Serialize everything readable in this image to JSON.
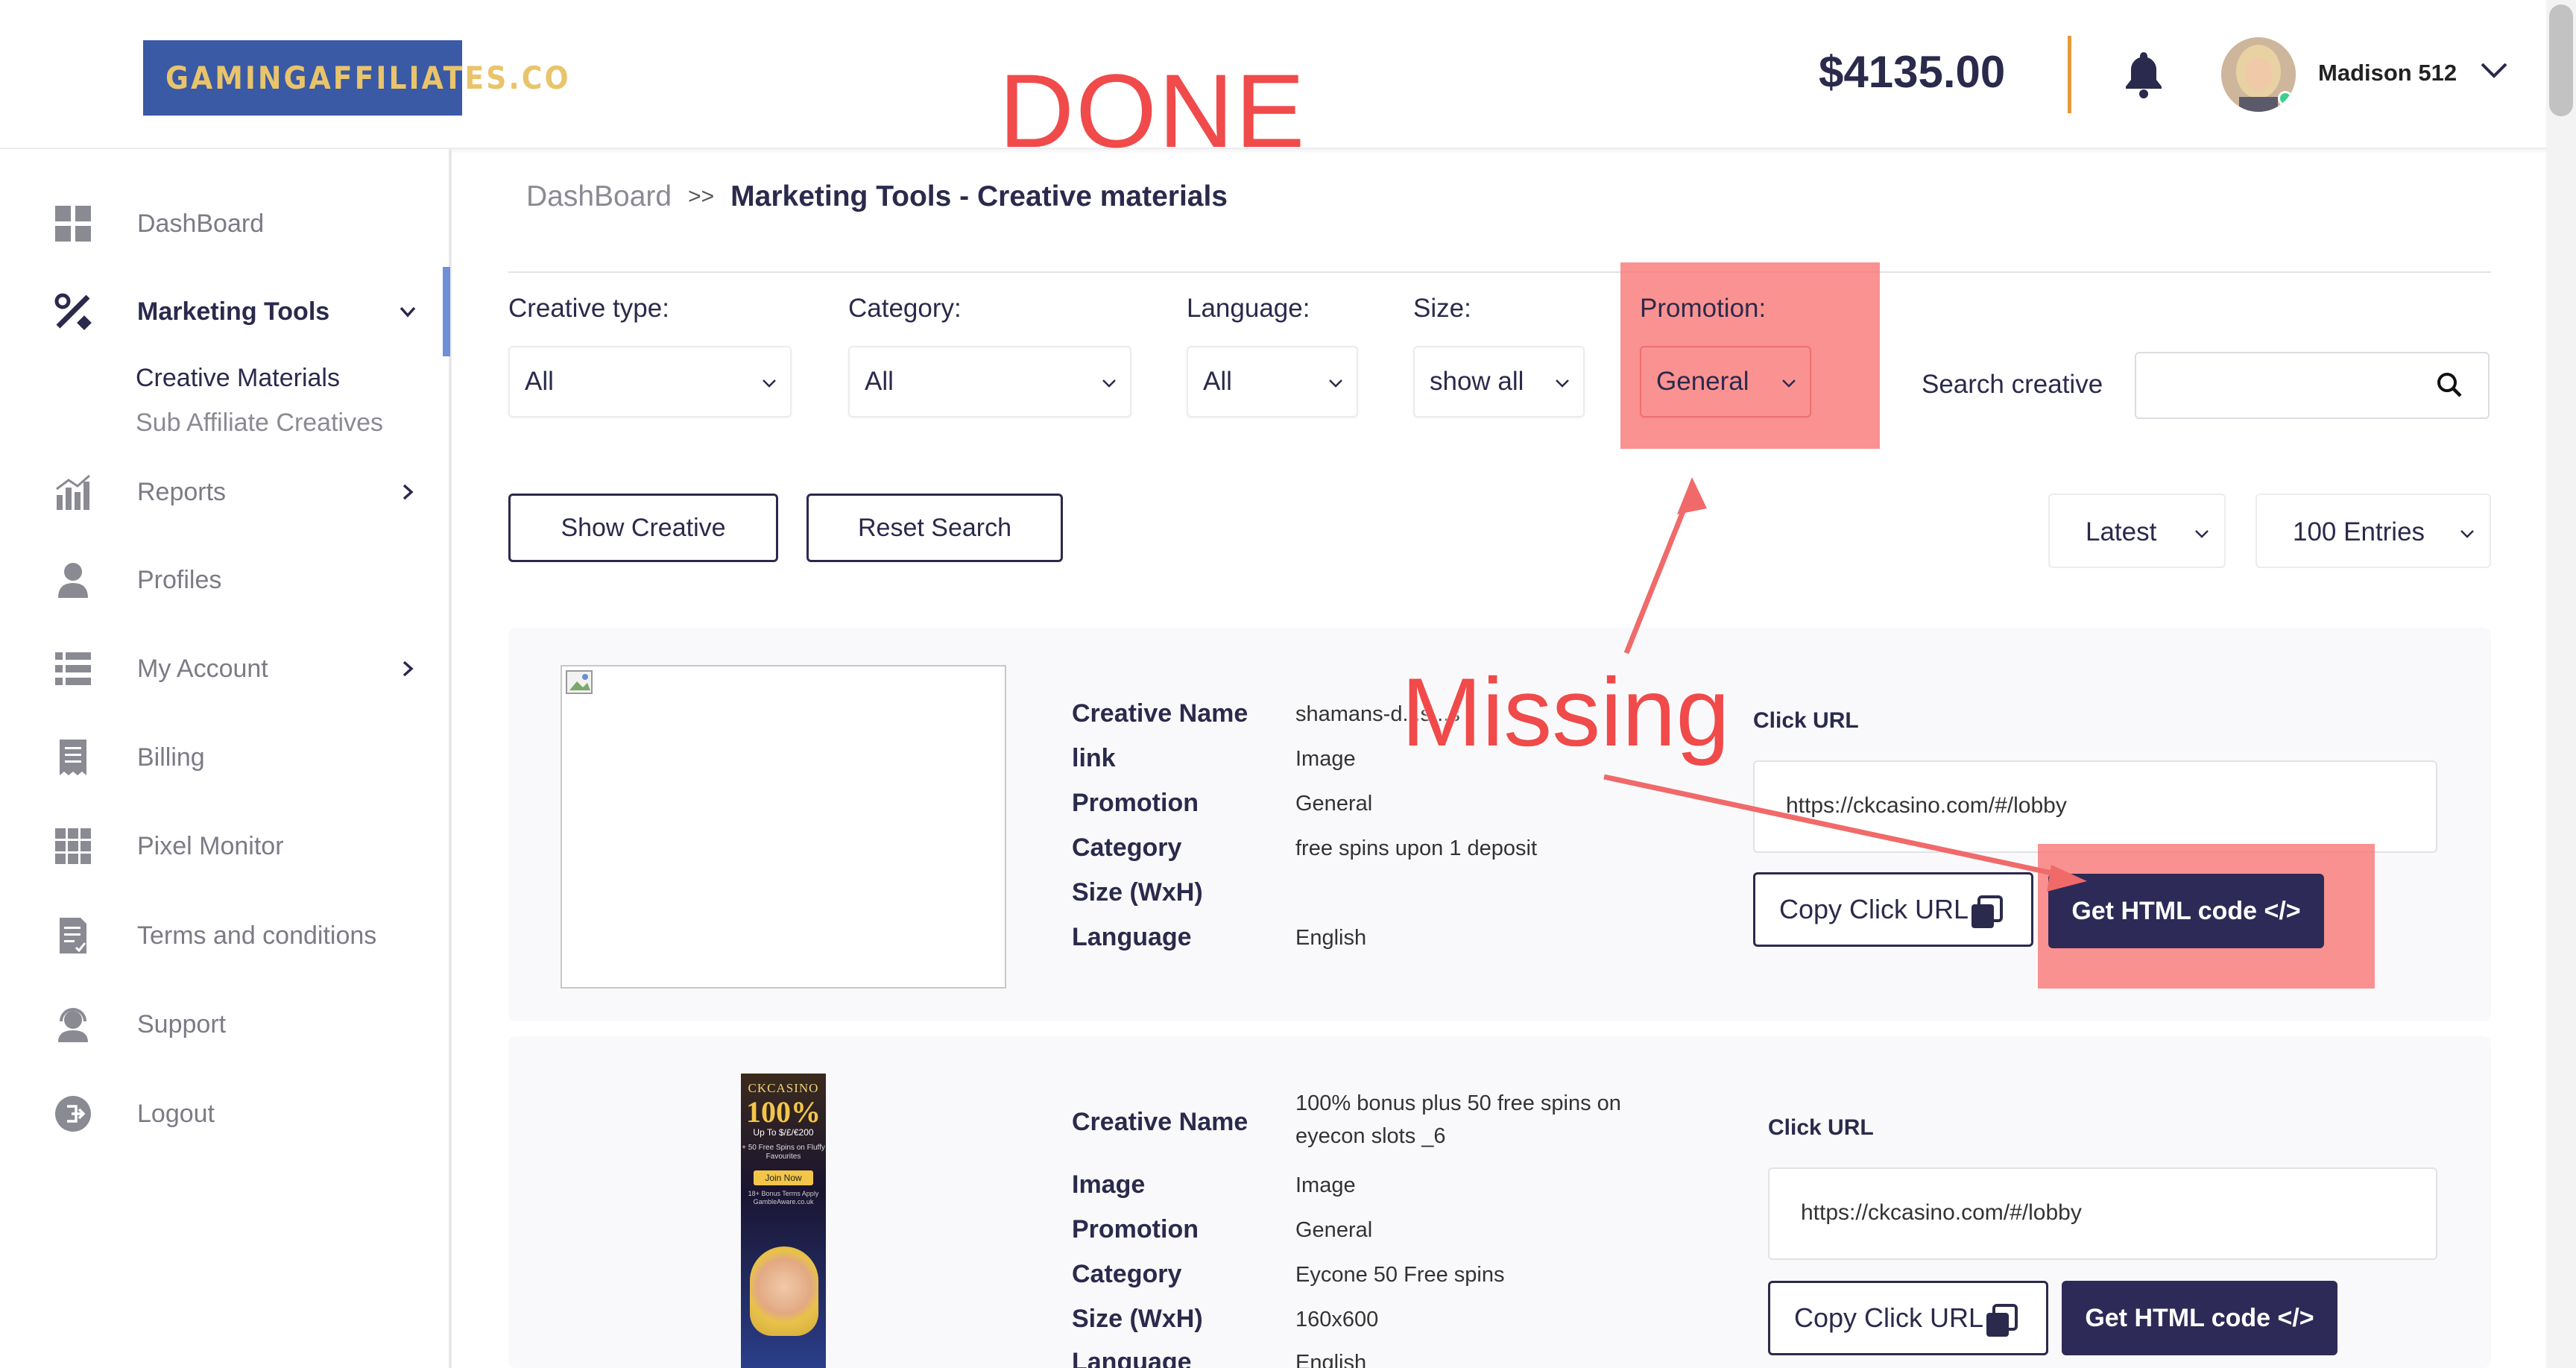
{
  "header": {
    "logo_text": "GAMINGAFFILIATES.CO",
    "balance": "$4135.00",
    "username": "Madison 512"
  },
  "annotations": {
    "done": "DONE",
    "missing": "Missing"
  },
  "sidebar": {
    "items": [
      {
        "label": "DashBoard",
        "icon": "dashboard-grid-icon"
      },
      {
        "label": "Marketing Tools",
        "icon": "tools-icon"
      },
      {
        "label": "Reports",
        "icon": "bar-chart-icon"
      },
      {
        "label": "Profiles",
        "icon": "user-icon"
      },
      {
        "label": "My Account",
        "icon": "list-icon"
      },
      {
        "label": "Billing",
        "icon": "receipt-icon"
      },
      {
        "label": "Pixel Monitor",
        "icon": "grid-icon"
      },
      {
        "label": "Terms and conditions",
        "icon": "document-icon"
      },
      {
        "label": "Support",
        "icon": "headset-icon"
      },
      {
        "label": "Logout",
        "icon": "logout-icon"
      }
    ],
    "subitems": [
      "Creative Materials",
      "Sub Affiliate Creatives"
    ]
  },
  "breadcrumb": {
    "root": "DashBoard",
    "separator": ">>",
    "current": "Marketing Tools - Creative materials"
  },
  "filters": {
    "creative_type": {
      "label": "Creative type:",
      "value": "All"
    },
    "category": {
      "label": "Category:",
      "value": "All"
    },
    "language": {
      "label": "Language:",
      "value": "All"
    },
    "size": {
      "label": "Size:",
      "value": "show all"
    },
    "promotion": {
      "label": "Promotion:",
      "value": "General"
    },
    "search_label": "Search creative",
    "search_value": ""
  },
  "actions": {
    "show_creative": "Show Creative",
    "reset_search": "Reset Search",
    "sort": "Latest",
    "entries": "100 Entries"
  },
  "creatives": [
    {
      "fields": [
        {
          "key": "Creative Name",
          "value": "shamans-d...s...s"
        },
        {
          "key": "link",
          "value": "Image"
        },
        {
          "key": "Promotion",
          "value": "General"
        },
        {
          "key": "Category",
          "value": "free spins upon 1 deposit"
        },
        {
          "key": "Size (WxH)",
          "value": ""
        },
        {
          "key": "Language",
          "value": "English"
        }
      ],
      "click_url_label": "Click URL",
      "click_url": "https://ckcasino.com/#/lobby",
      "copy_label": "Copy Click URL",
      "html_label": "Get HTML code </>"
    },
    {
      "banner": {
        "brand": "CKCASINO",
        "headline": "100%",
        "subline": "Up To $/£/€200",
        "extra": "+ 50 Free Spins on Fluffy Favourites",
        "cta": "Join Now",
        "tnc": "18+ Bonus Terms Apply GambleAware.co.uk"
      },
      "fields": [
        {
          "key": "Creative Name",
          "value": "100% bonus plus 50 free spins on eyecon slots _6"
        },
        {
          "key": "Image",
          "value": "Image"
        },
        {
          "key": "Promotion",
          "value": "General"
        },
        {
          "key": "Category",
          "value": "Eycone 50 Free spins"
        },
        {
          "key": "Size (WxH)",
          "value": "160x600"
        },
        {
          "key": "Language",
          "value": "English"
        }
      ],
      "click_url_label": "Click URL",
      "click_url": "https://ckcasino.com/#/lobby",
      "copy_label": "Copy Click URL",
      "html_label": "Get HTML code </>"
    }
  ],
  "colors": {
    "accent_navy": "#2e2a57",
    "annotation_red": "#f04a4a",
    "highlight": "#fa6e6e",
    "balance_separator": "#e59a3b"
  }
}
